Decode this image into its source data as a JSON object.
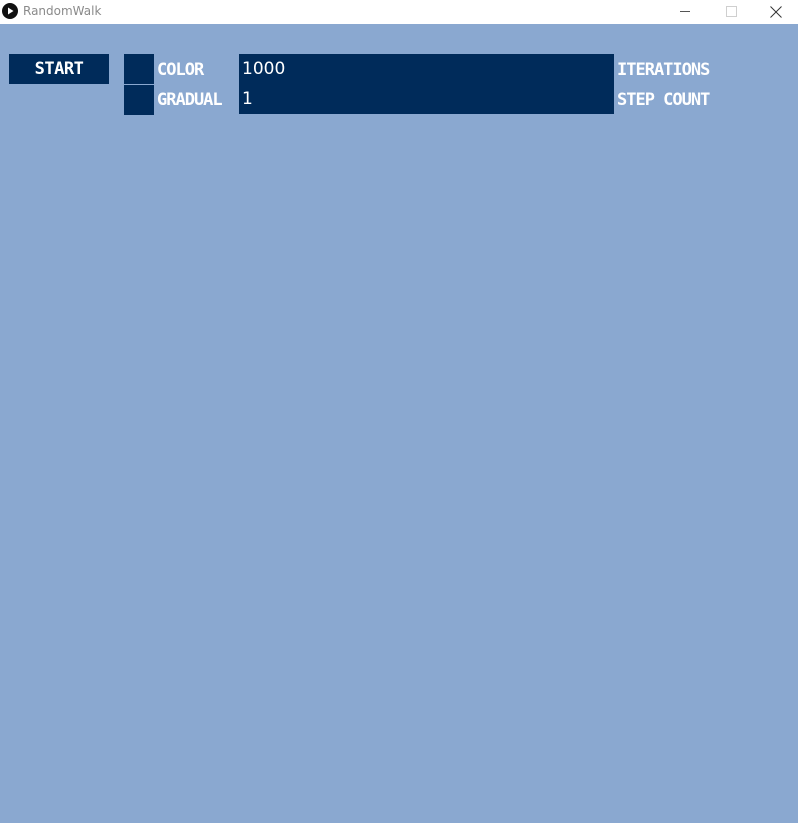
{
  "window": {
    "title": "RandomWalk",
    "icon": "play-icon",
    "controls": [
      "minimize-icon",
      "maximize-icon",
      "close-icon"
    ]
  },
  "colors": {
    "background": "#8aa8d0",
    "controls": "#002b5a",
    "text": "#ffffff"
  },
  "toolbar": {
    "start_label": "START",
    "toggles": [
      {
        "label": "COLOR",
        "checked": false
      },
      {
        "label": "GRADUAL",
        "checked": false
      }
    ],
    "fields": [
      {
        "value": "1000",
        "label": "ITERATIONS"
      },
      {
        "value": "1",
        "label": "STEP COUNT"
      }
    ]
  }
}
